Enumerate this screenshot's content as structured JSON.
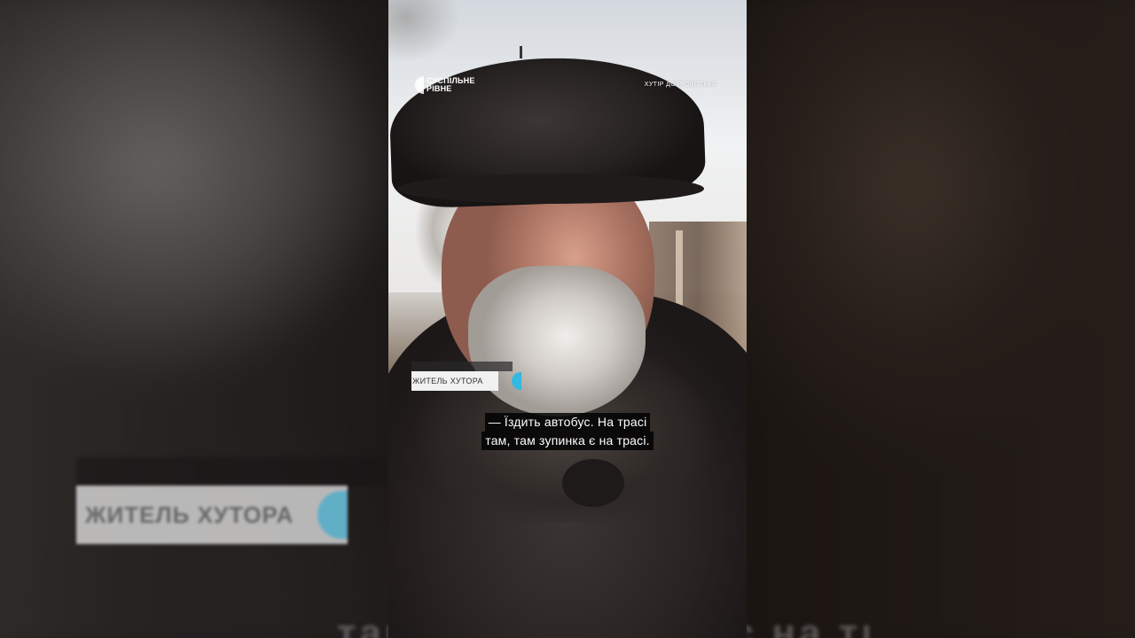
{
  "logo": {
    "line1": "СУСПІЛЬНЕ",
    "line2": "РІВНЕ"
  },
  "location": "ХУТІР ДОБРОВОЛЬКА",
  "lower_third": {
    "label": "ЖИТЕЛЬ ХУТОРА",
    "accent_color": "#33b8e0"
  },
  "subtitle": {
    "line1": "— Їздить автобус. На трасі",
    "line2": "там, там зупинка є на трасі."
  }
}
